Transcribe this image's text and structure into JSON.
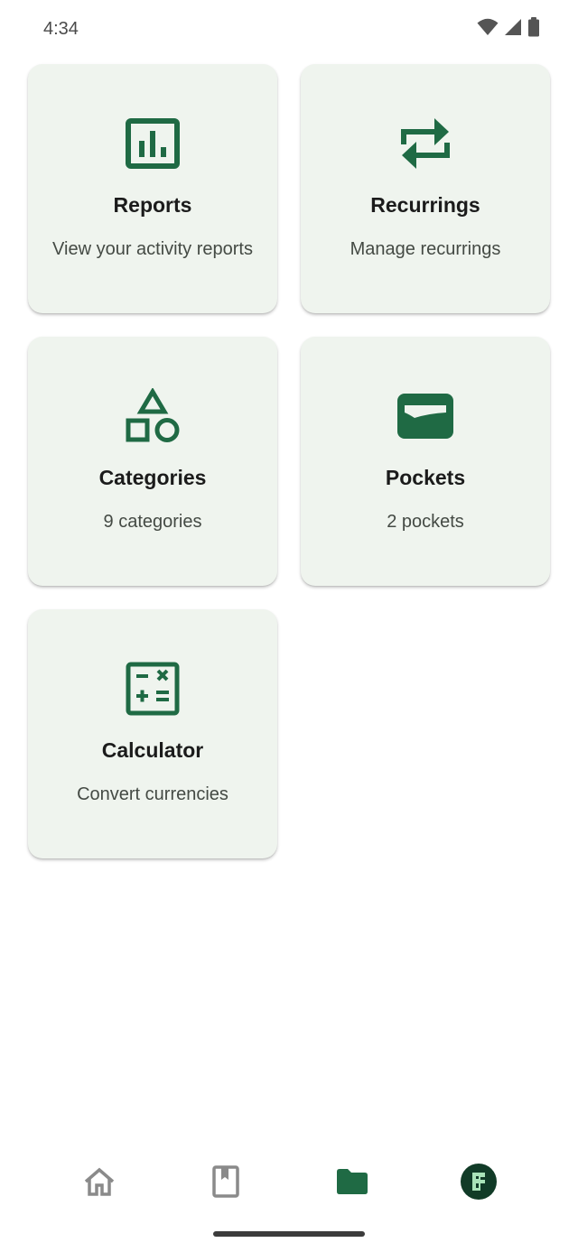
{
  "status_bar": {
    "time": "4:34",
    "icons": [
      "wifi-icon",
      "cellular-signal-icon",
      "battery-icon"
    ]
  },
  "colors": {
    "accent": "#1f6a44",
    "card_background": "#eff4ee",
    "nav_inactive": "#8a8a8a",
    "avatar_background": "#113b27",
    "avatar_glyph": "#a9e3b8"
  },
  "cards": [
    {
      "id": "reports",
      "icon": "bar-chart-icon",
      "title": "Reports",
      "subtitle": "View your activity reports"
    },
    {
      "id": "recurrings",
      "icon": "repeat-icon",
      "title": "Recurrings",
      "subtitle": "Manage recurrings"
    },
    {
      "id": "categories",
      "icon": "shapes-icon",
      "title": "Categories",
      "subtitle": "9 categories"
    },
    {
      "id": "pockets",
      "icon": "wallet-icon",
      "title": "Pockets",
      "subtitle": "2 pockets"
    },
    {
      "id": "calculator",
      "icon": "calculator-icon",
      "title": "Calculator",
      "subtitle": "Convert currencies"
    }
  ],
  "bottom_nav": {
    "items": [
      {
        "id": "home",
        "icon": "home-icon",
        "active": false
      },
      {
        "id": "bookmarks",
        "icon": "book-icon",
        "active": false
      },
      {
        "id": "folder",
        "icon": "folder-icon",
        "active": true
      },
      {
        "id": "profile",
        "icon": "avatar-icon",
        "active": false
      }
    ]
  }
}
